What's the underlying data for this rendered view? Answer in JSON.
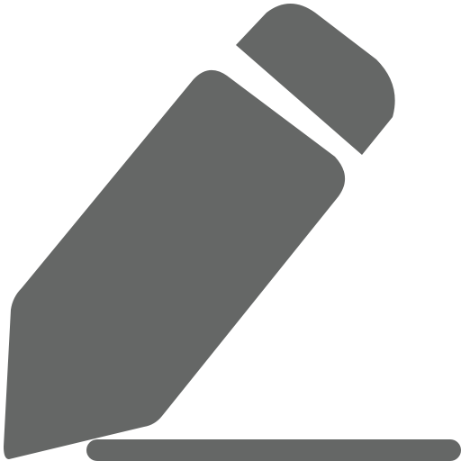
{
  "icon": {
    "name": "edit-pencil-icon",
    "color": "#656766",
    "background": "#ffffff"
  }
}
